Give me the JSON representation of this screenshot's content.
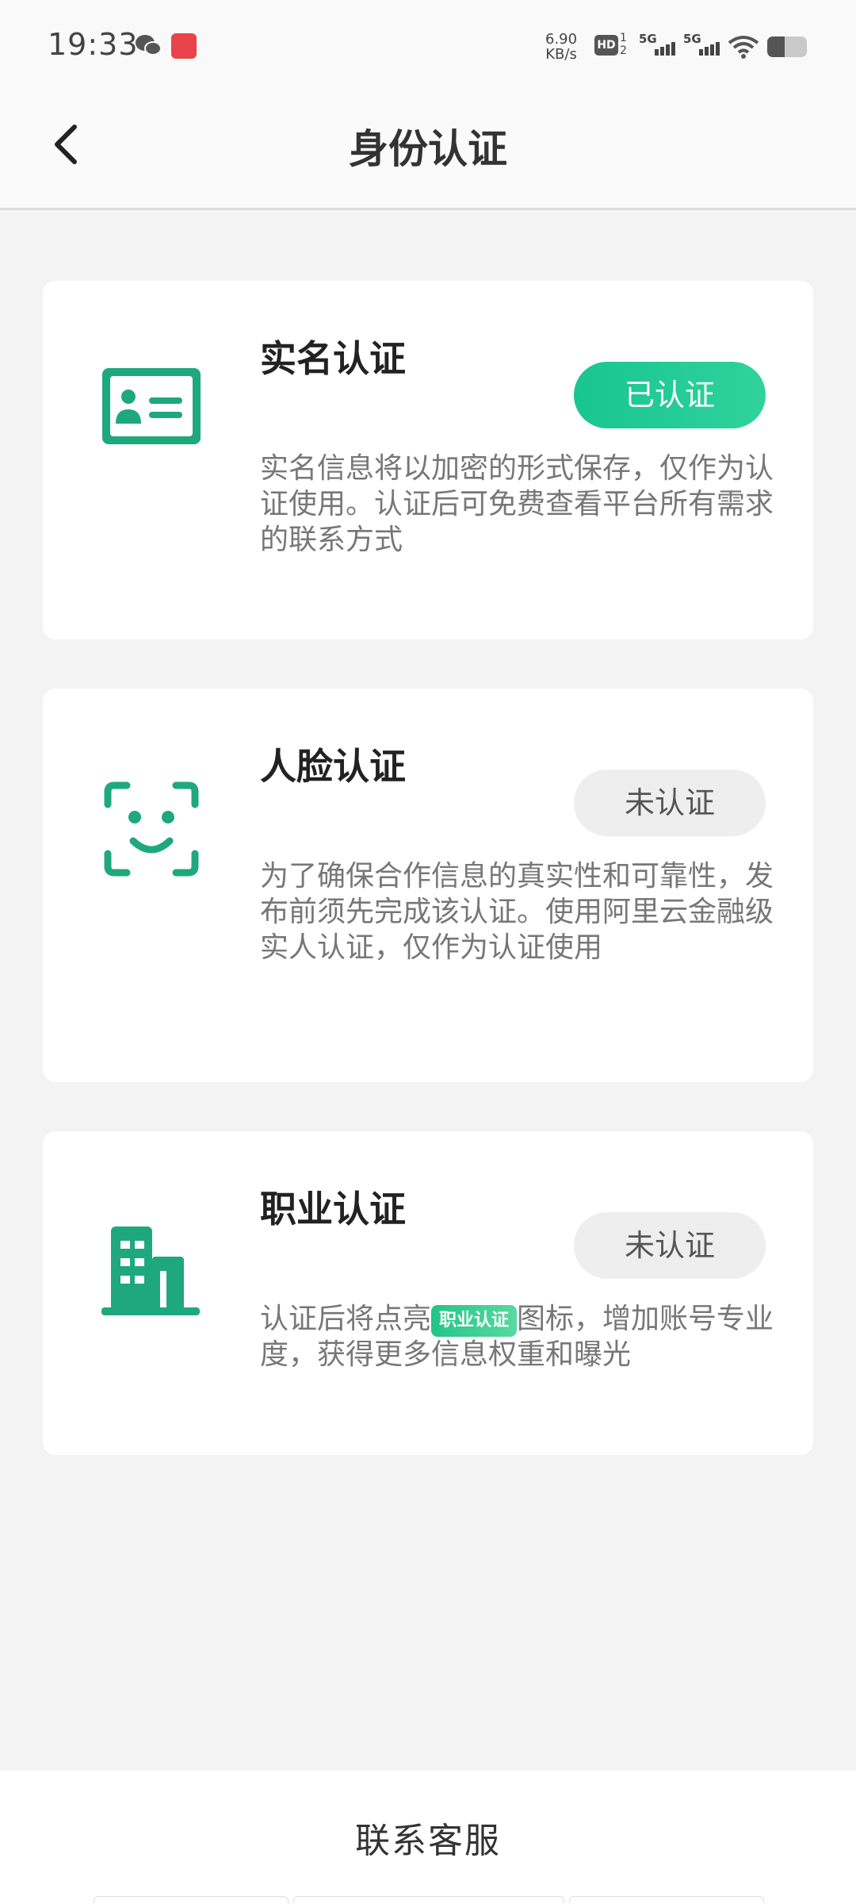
{
  "status_bar": {
    "time": "19:33",
    "net_speed_value": "6.90",
    "net_speed_unit": "KB/s",
    "hd_label": "HD",
    "hd_sup": "1",
    "hd_sub": "2",
    "sim1_label": "5G",
    "sim2_label": "5G",
    "icons": [
      "wechat-icon",
      "app-notification-icon",
      "hd-icon",
      "signal-icon",
      "signal-icon",
      "wifi-icon",
      "battery-icon"
    ]
  },
  "header": {
    "title": "身份认证",
    "back_icon": "chevron-left-icon"
  },
  "cards": [
    {
      "icon": "id-card-icon",
      "title": "实名认证",
      "status": "已认证",
      "desc": "实名信息将以加密的形式保存，仅作为认证使用。认证后可免费查看平台所有需求的联系方式"
    },
    {
      "icon": "face-scan-icon",
      "title": "人脸认证",
      "status": "未认证",
      "desc": "为了确保合作信息的真实性和可靠性，发布前须先完成该认证。使用阿里云金融级实人认证，仅作为认证使用"
    },
    {
      "icon": "building-icon",
      "title": "职业认证",
      "status": "未认证",
      "desc_before": "认证后将点亮",
      "badge": "职业认证",
      "desc_after": "图标，增加账号专业度，获得更多信息权重和曝光"
    }
  ],
  "colors": {
    "accent": "#1fb98a",
    "verified_pill": "#22c993",
    "unverified_pill": "#eeeeee",
    "background": "#f3f3f3"
  },
  "footer": {
    "contact_label": "联系客服"
  }
}
